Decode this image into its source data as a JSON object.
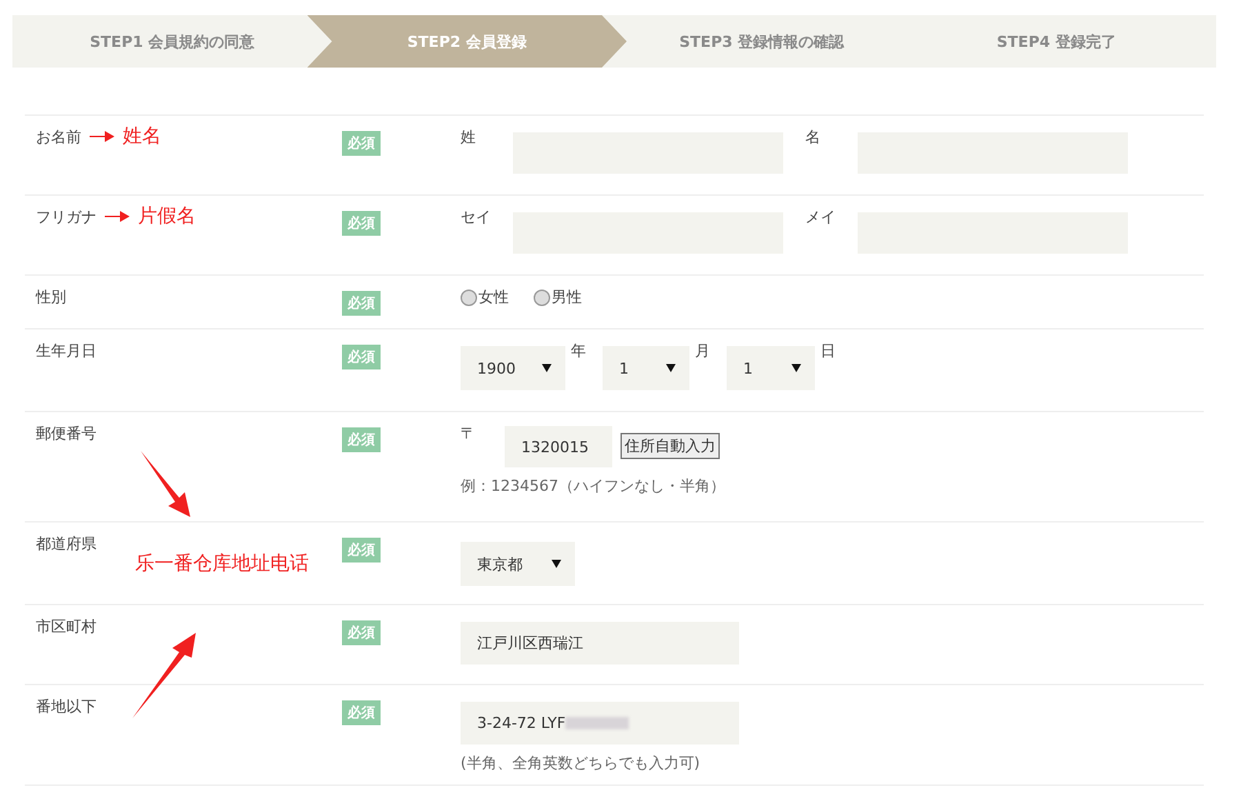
{
  "steps": [
    {
      "label": "STEP1 会員規約の同意",
      "selected": false
    },
    {
      "label": "STEP2 会員登録",
      "selected": true
    },
    {
      "label": "STEP3 登録情報の確認",
      "selected": false
    },
    {
      "label": "STEP4 登録完了",
      "selected": false
    }
  ],
  "rows": [
    {
      "kind": "pair",
      "label": "お名前",
      "badge": "必須",
      "annotation": "姓名",
      "fields": [
        {
          "label": "姓"
        },
        {
          "label": "名"
        }
      ]
    },
    {
      "kind": "pair",
      "label": "フリガナ",
      "badge": "必須",
      "annotation": "片假名",
      "fields": [
        {
          "label": "セイ"
        },
        {
          "label": "メイ"
        }
      ]
    },
    {
      "kind": "radio",
      "label": "性別",
      "badge": "必須",
      "options": [
        {
          "label": "女性",
          "selected": false
        },
        {
          "label": "男性",
          "selected": false
        }
      ]
    },
    {
      "kind": "date",
      "label": "生年月日",
      "badge": "必須",
      "parts": [
        {
          "value": "1900",
          "unit": "年"
        },
        {
          "value": "1",
          "unit": "月"
        },
        {
          "value": "1",
          "unit": "日"
        }
      ]
    },
    {
      "kind": "zip",
      "label": "郵便番号",
      "badge": "必須",
      "prefix": "〒",
      "value": "1320015",
      "button": "住所自動入力",
      "note": "例：1234567（ハイフンなし・半角）"
    },
    {
      "kind": "select",
      "label": "都道府県",
      "badge": "必須",
      "value": "東京都"
    },
    {
      "kind": "text",
      "label": "市区町村",
      "badge": "必須",
      "value": "江戸川区西瑞江"
    },
    {
      "kind": "text",
      "label": "番地以下",
      "badge": "必須",
      "value": "3-24-72 LYF",
      "redacted": true,
      "note": "(半角、全角英数どちらでも入力可)"
    }
  ],
  "overlay_note": "乐一番仓库地址电话"
}
